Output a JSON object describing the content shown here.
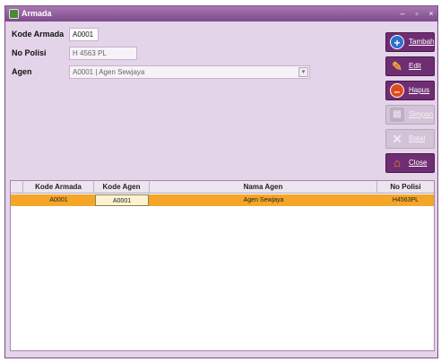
{
  "window": {
    "title": "Armada",
    "controls": {
      "minimize": "–",
      "restore": "▫",
      "close": "×"
    }
  },
  "form": {
    "kode_armada": {
      "label": "Kode Armada",
      "value": "A0001"
    },
    "no_polisi": {
      "label": "No Polisi",
      "value": "H 4563 PL"
    },
    "agen": {
      "label": "Agen",
      "value": "A0001 | Agen Sewjaya"
    }
  },
  "buttons": {
    "tambah": "Tambah",
    "edit": "Edit",
    "hapus": "Hapus",
    "simpan": "Simpan",
    "batal": "Batal",
    "close": "Close"
  },
  "grid": {
    "columns": [
      "Kode Armada",
      "Kode Agen",
      "Nama Agen",
      "No Polisi"
    ],
    "rows": [
      [
        "A0001",
        "A0001",
        "Agen Sewjaya",
        "H4563PL"
      ]
    ]
  },
  "colors": {
    "window_bg": "#e4d4e9",
    "titlebar": "#7e4a8a",
    "button": "#6f2e73",
    "selected_row": "#f5a628"
  }
}
